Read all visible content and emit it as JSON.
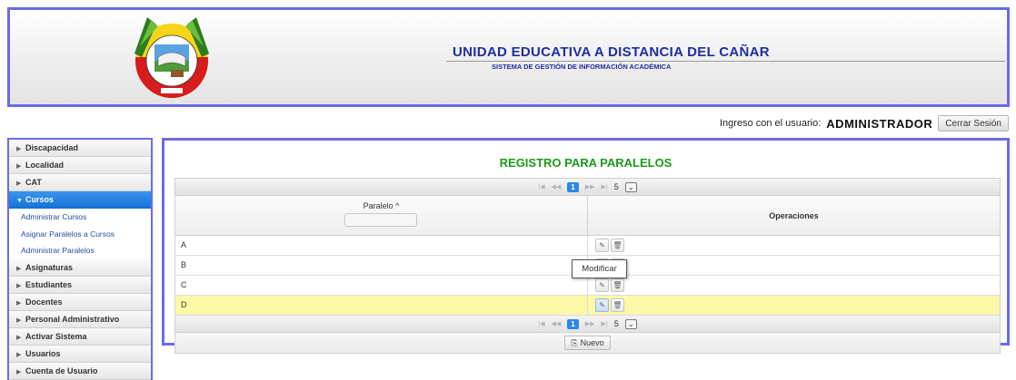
{
  "header": {
    "title": "UNIDAD EDUCATIVA A DISTANCIA DEL CAÑAR",
    "subtitle": "SISTEMA DE GESTIÓN DE INFORMACIÓN ACADÉMICA",
    "logo_text": "UNIDAD EDUCATIVA A DISTANCIA"
  },
  "userbar": {
    "label": "Ingreso con el usuario:",
    "username": "ADMINISTRADOR",
    "logout_label": "Cerrar Sesión"
  },
  "sidebar": {
    "items_top": [
      {
        "label": "Discapacidad"
      },
      {
        "label": "Localidad"
      },
      {
        "label": "CAT"
      }
    ],
    "active": {
      "label": "Cursos"
    },
    "submenu": [
      {
        "label": "Administrar Cursos"
      },
      {
        "label": "Asignar Paralelos a Cursos"
      },
      {
        "label": "Administrar Paralelos"
      }
    ],
    "items_bottom": [
      {
        "label": "Asignaturas"
      },
      {
        "label": "Estudiantes"
      },
      {
        "label": "Docentes"
      },
      {
        "label": "Personal Administrativo"
      },
      {
        "label": "Activar Sistema"
      },
      {
        "label": "Usuarios"
      },
      {
        "label": "Cuenta de Usuario"
      }
    ]
  },
  "main": {
    "title": "REGISTRO PARA PARALELOS",
    "pager": {
      "current_page": "1",
      "rows_per_page": "5"
    },
    "columns": {
      "paralelo": "Paralelo ^",
      "operaciones": "Operaciones"
    },
    "rows": [
      {
        "paralelo": "A"
      },
      {
        "paralelo": "B"
      },
      {
        "paralelo": "C"
      },
      {
        "paralelo": "D"
      }
    ],
    "new_label": "Nuevo",
    "tooltip": "Modificar"
  },
  "colors": {
    "accent": "#2b88e0",
    "frame": "#6b6be8",
    "title_green": "#1c9a1c",
    "header_blue": "#1e2fa0",
    "highlight_row": "#fdf8a8"
  }
}
